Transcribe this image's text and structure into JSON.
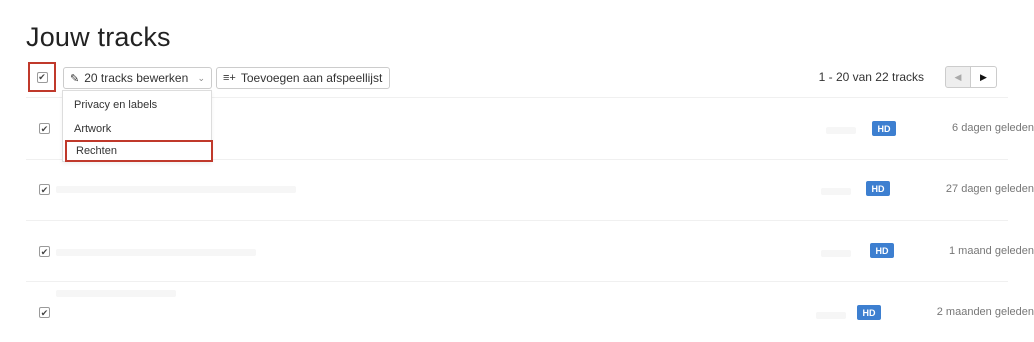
{
  "page": {
    "title": "Jouw tracks"
  },
  "toolbar": {
    "edit_label": "20 tracks bewerken",
    "add_label": "Toevoegen aan afspeellijst",
    "pagination": "1 - 20 van 22 tracks"
  },
  "dropdown": {
    "items": [
      {
        "label": "Privacy en labels"
      },
      {
        "label": "Artwork"
      },
      {
        "label": "Rechten"
      }
    ]
  },
  "tracks": [
    {
      "badge": "HD",
      "age": "6 dagen geleden",
      "checked": true
    },
    {
      "badge": "HD",
      "age": "27 dagen geleden",
      "checked": true
    },
    {
      "badge": "HD",
      "age": "1 maand geleden",
      "checked": true
    },
    {
      "badge": "HD",
      "age": "2 maanden geleden",
      "checked": true
    }
  ],
  "colors": {
    "accent_highlight": "#c0392b",
    "hd_badge": "#3d7fd0"
  },
  "icons": {
    "edit": "pencil-icon",
    "add": "playlist-add-icon",
    "dropdown": "chevron-down-icon",
    "prev": "triangle-left-icon",
    "next": "triangle-right-icon"
  }
}
